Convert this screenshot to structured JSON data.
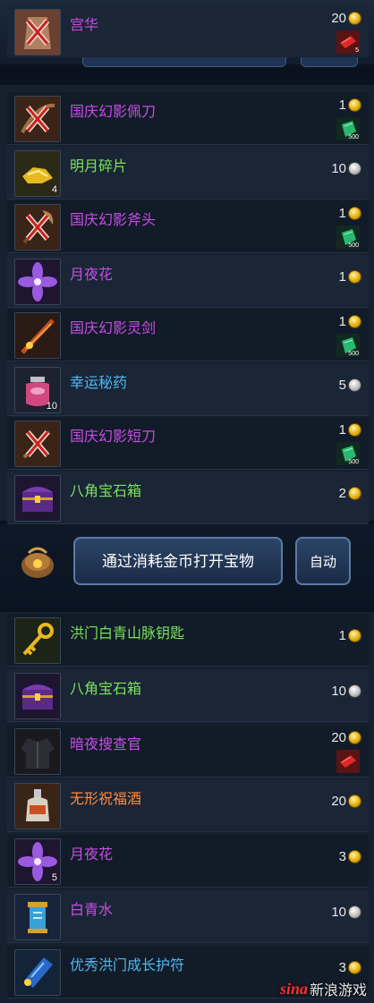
{
  "top_item": {
    "name": "宫华",
    "cost": "20",
    "currency": "gold",
    "sub_item": "red-ticket",
    "sub_count": "5"
  },
  "lottery_list": [
    {
      "name": "国庆幻影佩刀",
      "color": "purple",
      "cost": "1",
      "currency": "gold",
      "icon": "locked-sword-icon",
      "qty": "",
      "sub_item": "green-gem",
      "sub_count": "500"
    },
    {
      "name": "明月碎片",
      "color": "green",
      "cost": "10",
      "currency": "silver",
      "icon": "gold-fragment-icon",
      "qty": "4",
      "sub_item": "",
      "sub_count": ""
    },
    {
      "name": "国庆幻影斧头",
      "color": "purple",
      "cost": "1",
      "currency": "gold",
      "icon": "locked-axe-icon",
      "qty": "",
      "sub_item": "green-gem",
      "sub_count": "500"
    },
    {
      "name": "月夜花",
      "color": "purple",
      "cost": "1",
      "currency": "gold",
      "icon": "purple-flower-icon",
      "qty": "",
      "sub_item": "",
      "sub_count": ""
    },
    {
      "name": "国庆幻影灵剑",
      "color": "purple",
      "cost": "1",
      "currency": "gold",
      "icon": "spirit-sword-icon",
      "qty": "",
      "sub_item": "green-gem",
      "sub_count": "500"
    },
    {
      "name": "幸运秘药",
      "color": "blue",
      "cost": "5",
      "currency": "silver",
      "icon": "potion-jar-icon",
      "qty": "10",
      "sub_item": "",
      "sub_count": ""
    },
    {
      "name": "国庆幻影短刀",
      "color": "purple",
      "cost": "1",
      "currency": "gold",
      "icon": "locked-dagger-icon",
      "qty": "",
      "sub_item": "green-gem",
      "sub_count": "500"
    },
    {
      "name": "八角宝石箱",
      "color": "green",
      "cost": "2",
      "currency": "gold",
      "icon": "gem-chest-icon",
      "qty": "",
      "sub_item": "",
      "sub_count": ""
    }
  ],
  "action_bar": {
    "open_label": "通过消耗金币打开宝物",
    "auto_label": "自动"
  },
  "reward_list": [
    {
      "name": "洪门白青山脉钥匙",
      "color": "green",
      "cost": "1",
      "currency": "gold",
      "icon": "golden-key-icon",
      "qty": "",
      "sub_item": ""
    },
    {
      "name": "八角宝石箱",
      "color": "green",
      "cost": "10",
      "currency": "silver",
      "icon": "gem-chest-icon",
      "qty": "",
      "sub_item": ""
    },
    {
      "name": "暗夜搜查官",
      "color": "purple",
      "cost": "20",
      "currency": "gold",
      "icon": "dark-jacket-icon",
      "qty": "",
      "sub_item": "red-ticket"
    },
    {
      "name": "无形祝福酒",
      "color": "orange",
      "cost": "20",
      "currency": "gold",
      "icon": "wine-bottle-icon",
      "qty": "",
      "sub_item": ""
    },
    {
      "name": "月夜花",
      "color": "purple",
      "cost": "3",
      "currency": "gold",
      "icon": "purple-flower-icon",
      "qty": "5",
      "sub_item": ""
    },
    {
      "name": "白青水",
      "color": "purple",
      "cost": "10",
      "currency": "silver",
      "icon": "water-lantern-icon",
      "qty": "",
      "sub_item": ""
    },
    {
      "name": "优秀洪门成长护符",
      "color": "blue",
      "cost": "3",
      "currency": "gold",
      "icon": "growth-charm-icon",
      "qty": "",
      "sub_item": ""
    }
  ],
  "watermark": {
    "logo": "sina",
    "text": "新浪游戏"
  },
  "colors": {
    "purple": "#c64ee6",
    "green": "#7ae25a",
    "blue": "#4fb8f0",
    "orange": "#ff8a3c"
  }
}
